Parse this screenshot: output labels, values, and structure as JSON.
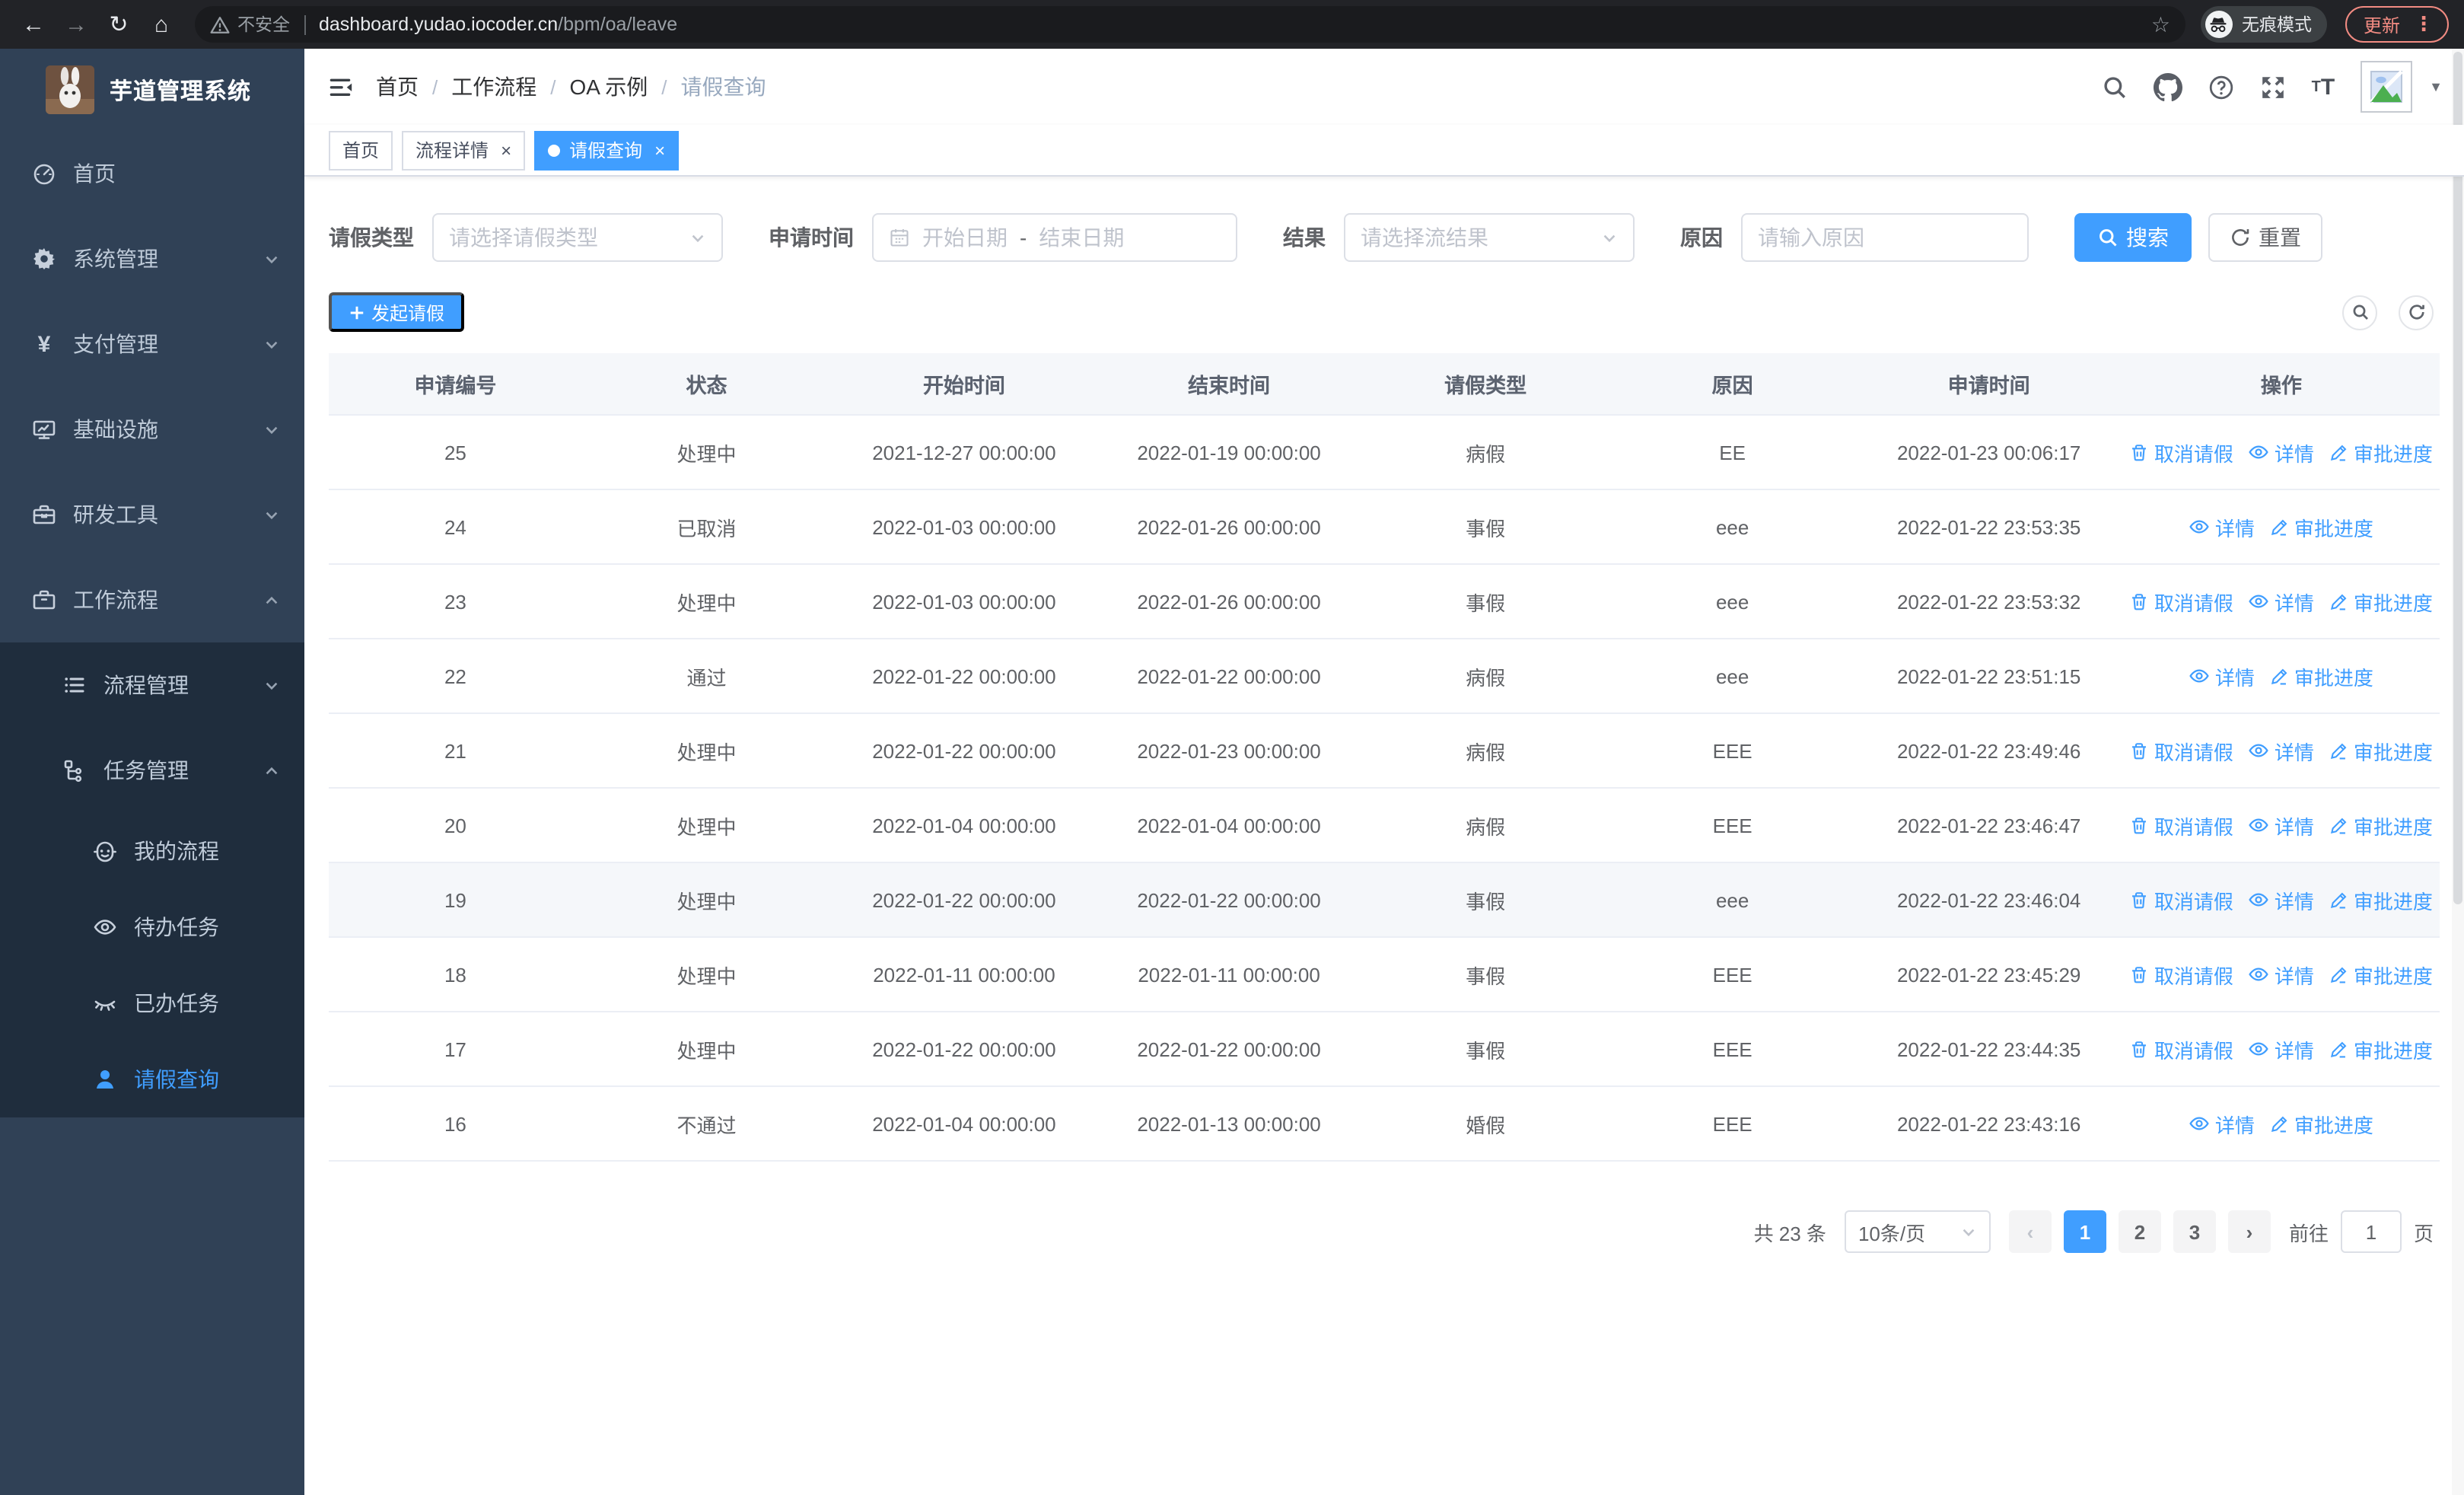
{
  "browser": {
    "security_label": "不安全",
    "url_host": "dashboard.yudao.iocoder.cn",
    "url_path": "/bpm/oa/leave",
    "incognito_label": "无痕模式",
    "update_label": "更新"
  },
  "sidebar": {
    "title": "芋道管理系统",
    "items": [
      {
        "label": "首页",
        "icon": "gauge",
        "level": 1,
        "arrow": null,
        "active": false
      },
      {
        "label": "系统管理",
        "icon": "gear",
        "level": 1,
        "arrow": "down",
        "active": false
      },
      {
        "label": "支付管理",
        "icon": "yen",
        "level": 1,
        "arrow": "down",
        "active": false
      },
      {
        "label": "基础设施",
        "icon": "monitor",
        "level": 1,
        "arrow": "down",
        "active": false
      },
      {
        "label": "研发工具",
        "icon": "toolbox",
        "level": 1,
        "arrow": "down",
        "active": false
      },
      {
        "label": "工作流程",
        "icon": "briefcase",
        "level": 1,
        "arrow": "up",
        "active": false
      },
      {
        "label": "流程管理",
        "icon": "list",
        "level": 2,
        "arrow": "down",
        "active": false
      },
      {
        "label": "任务管理",
        "icon": "tree",
        "level": 2,
        "arrow": "up",
        "active": false
      },
      {
        "label": "我的流程",
        "icon": "robot",
        "level": 3,
        "arrow": null,
        "active": false
      },
      {
        "label": "待办任务",
        "icon": "eye-open",
        "level": 3,
        "arrow": null,
        "active": false
      },
      {
        "label": "已办任务",
        "icon": "eye-closed",
        "level": 3,
        "arrow": null,
        "active": false
      },
      {
        "label": "请假查询",
        "icon": "user",
        "level": 3,
        "arrow": null,
        "active": true
      }
    ]
  },
  "breadcrumb": [
    "首页",
    "工作流程",
    "OA 示例",
    "请假查询"
  ],
  "tabs": [
    {
      "label": "首页",
      "closable": false,
      "active": false
    },
    {
      "label": "流程详情",
      "closable": true,
      "active": false
    },
    {
      "label": "请假查询",
      "closable": true,
      "active": true
    }
  ],
  "filters": {
    "leave_type": {
      "label": "请假类型",
      "placeholder": "请选择请假类型"
    },
    "apply_time": {
      "label": "申请时间",
      "start_placeholder": "开始日期",
      "separator": "-",
      "end_placeholder": "结束日期"
    },
    "result": {
      "label": "结果",
      "placeholder": "请选择流结果"
    },
    "reason": {
      "label": "原因",
      "placeholder": "请输入原因"
    },
    "search_label": "搜索",
    "reset_label": "重置"
  },
  "toolbar": {
    "create_label": "发起请假"
  },
  "table": {
    "columns": [
      "申请编号",
      "状态",
      "开始时间",
      "结束时间",
      "请假类型",
      "原因",
      "申请时间",
      "操作"
    ],
    "action_labels": {
      "cancel": "取消请假",
      "detail": "详情",
      "progress": "审批进度"
    },
    "rows": [
      {
        "id": "25",
        "status": "处理中",
        "start": "2021-12-27 00:00:00",
        "end": "2022-01-19 00:00:00",
        "type": "病假",
        "reason": "EE",
        "applied": "2022-01-23 00:06:17",
        "actions": [
          "cancel",
          "detail",
          "progress"
        ],
        "highlighted": false
      },
      {
        "id": "24",
        "status": "已取消",
        "start": "2022-01-03 00:00:00",
        "end": "2022-01-26 00:00:00",
        "type": "事假",
        "reason": "eee",
        "applied": "2022-01-22 23:53:35",
        "actions": [
          "detail",
          "progress"
        ],
        "highlighted": false
      },
      {
        "id": "23",
        "status": "处理中",
        "start": "2022-01-03 00:00:00",
        "end": "2022-01-26 00:00:00",
        "type": "事假",
        "reason": "eee",
        "applied": "2022-01-22 23:53:32",
        "actions": [
          "cancel",
          "detail",
          "progress"
        ],
        "highlighted": false
      },
      {
        "id": "22",
        "status": "通过",
        "start": "2022-01-22 00:00:00",
        "end": "2022-01-22 00:00:00",
        "type": "病假",
        "reason": "eee",
        "applied": "2022-01-22 23:51:15",
        "actions": [
          "detail",
          "progress"
        ],
        "highlighted": false
      },
      {
        "id": "21",
        "status": "处理中",
        "start": "2022-01-22 00:00:00",
        "end": "2022-01-23 00:00:00",
        "type": "病假",
        "reason": "EEE",
        "applied": "2022-01-22 23:49:46",
        "actions": [
          "cancel",
          "detail",
          "progress"
        ],
        "highlighted": false
      },
      {
        "id": "20",
        "status": "处理中",
        "start": "2022-01-04 00:00:00",
        "end": "2022-01-04 00:00:00",
        "type": "病假",
        "reason": "EEE",
        "applied": "2022-01-22 23:46:47",
        "actions": [
          "cancel",
          "detail",
          "progress"
        ],
        "highlighted": false
      },
      {
        "id": "19",
        "status": "处理中",
        "start": "2022-01-22 00:00:00",
        "end": "2022-01-22 00:00:00",
        "type": "事假",
        "reason": "eee",
        "applied": "2022-01-22 23:46:04",
        "actions": [
          "cancel",
          "detail",
          "progress"
        ],
        "highlighted": true
      },
      {
        "id": "18",
        "status": "处理中",
        "start": "2022-01-11 00:00:00",
        "end": "2022-01-11 00:00:00",
        "type": "事假",
        "reason": "EEE",
        "applied": "2022-01-22 23:45:29",
        "actions": [
          "cancel",
          "detail",
          "progress"
        ],
        "highlighted": false
      },
      {
        "id": "17",
        "status": "处理中",
        "start": "2022-01-22 00:00:00",
        "end": "2022-01-22 00:00:00",
        "type": "事假",
        "reason": "EEE",
        "applied": "2022-01-22 23:44:35",
        "actions": [
          "cancel",
          "detail",
          "progress"
        ],
        "highlighted": false
      },
      {
        "id": "16",
        "status": "不通过",
        "start": "2022-01-04 00:00:00",
        "end": "2022-01-13 00:00:00",
        "type": "婚假",
        "reason": "EEE",
        "applied": "2022-01-22 23:43:16",
        "actions": [
          "detail",
          "progress"
        ],
        "highlighted": false
      }
    ]
  },
  "pagination": {
    "total_label": "共 23 条",
    "page_size": "10条/页",
    "pages": [
      "1",
      "2",
      "3"
    ],
    "current_page": "1",
    "goto_label": "前往",
    "goto_value": "1",
    "unit_label": "页"
  },
  "colors": {
    "primary": "#409eff",
    "sidebar_bg": "#304156",
    "submenu_bg": "#1f2d3d",
    "menu_text": "#bfcbd9",
    "update_accent": "#f28b82"
  }
}
